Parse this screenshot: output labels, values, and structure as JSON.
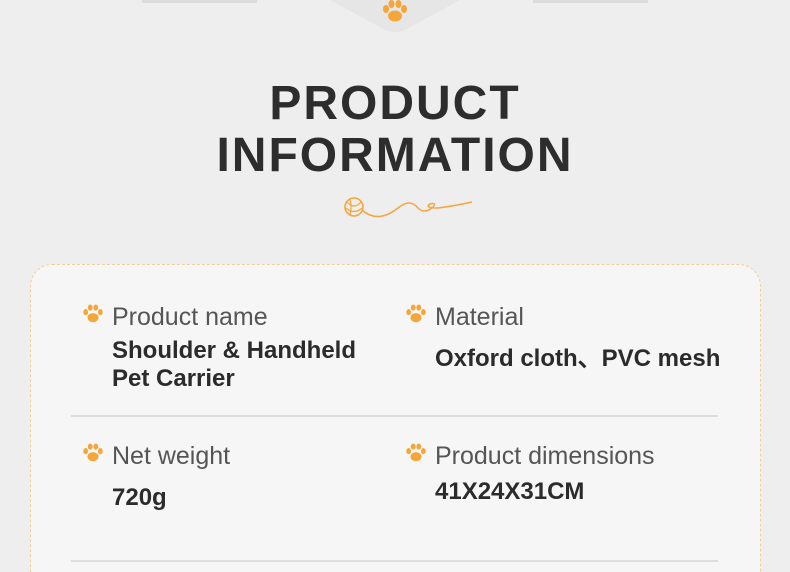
{
  "header": {
    "title_line1": "PRODUCT",
    "title_line2": "INFORMATION",
    "paw_icon": "paw-icon",
    "decoration": "yarn-ball-icon"
  },
  "info": {
    "product_name": {
      "label": "Product name",
      "value_line1": "Shoulder & Handheld",
      "value_line2": "Pet Carrier"
    },
    "material": {
      "label": "Material",
      "value": "Oxford cloth、PVC mesh"
    },
    "net_weight": {
      "label": "Net weight",
      "value": "720g"
    },
    "dimensions": {
      "label": "Product dimensions",
      "value": "41X24X31CM"
    }
  },
  "colors": {
    "accent": "#f5a63b",
    "background": "#eeeeee",
    "card": "#f6f6f6",
    "title": "#2d2d2d"
  }
}
